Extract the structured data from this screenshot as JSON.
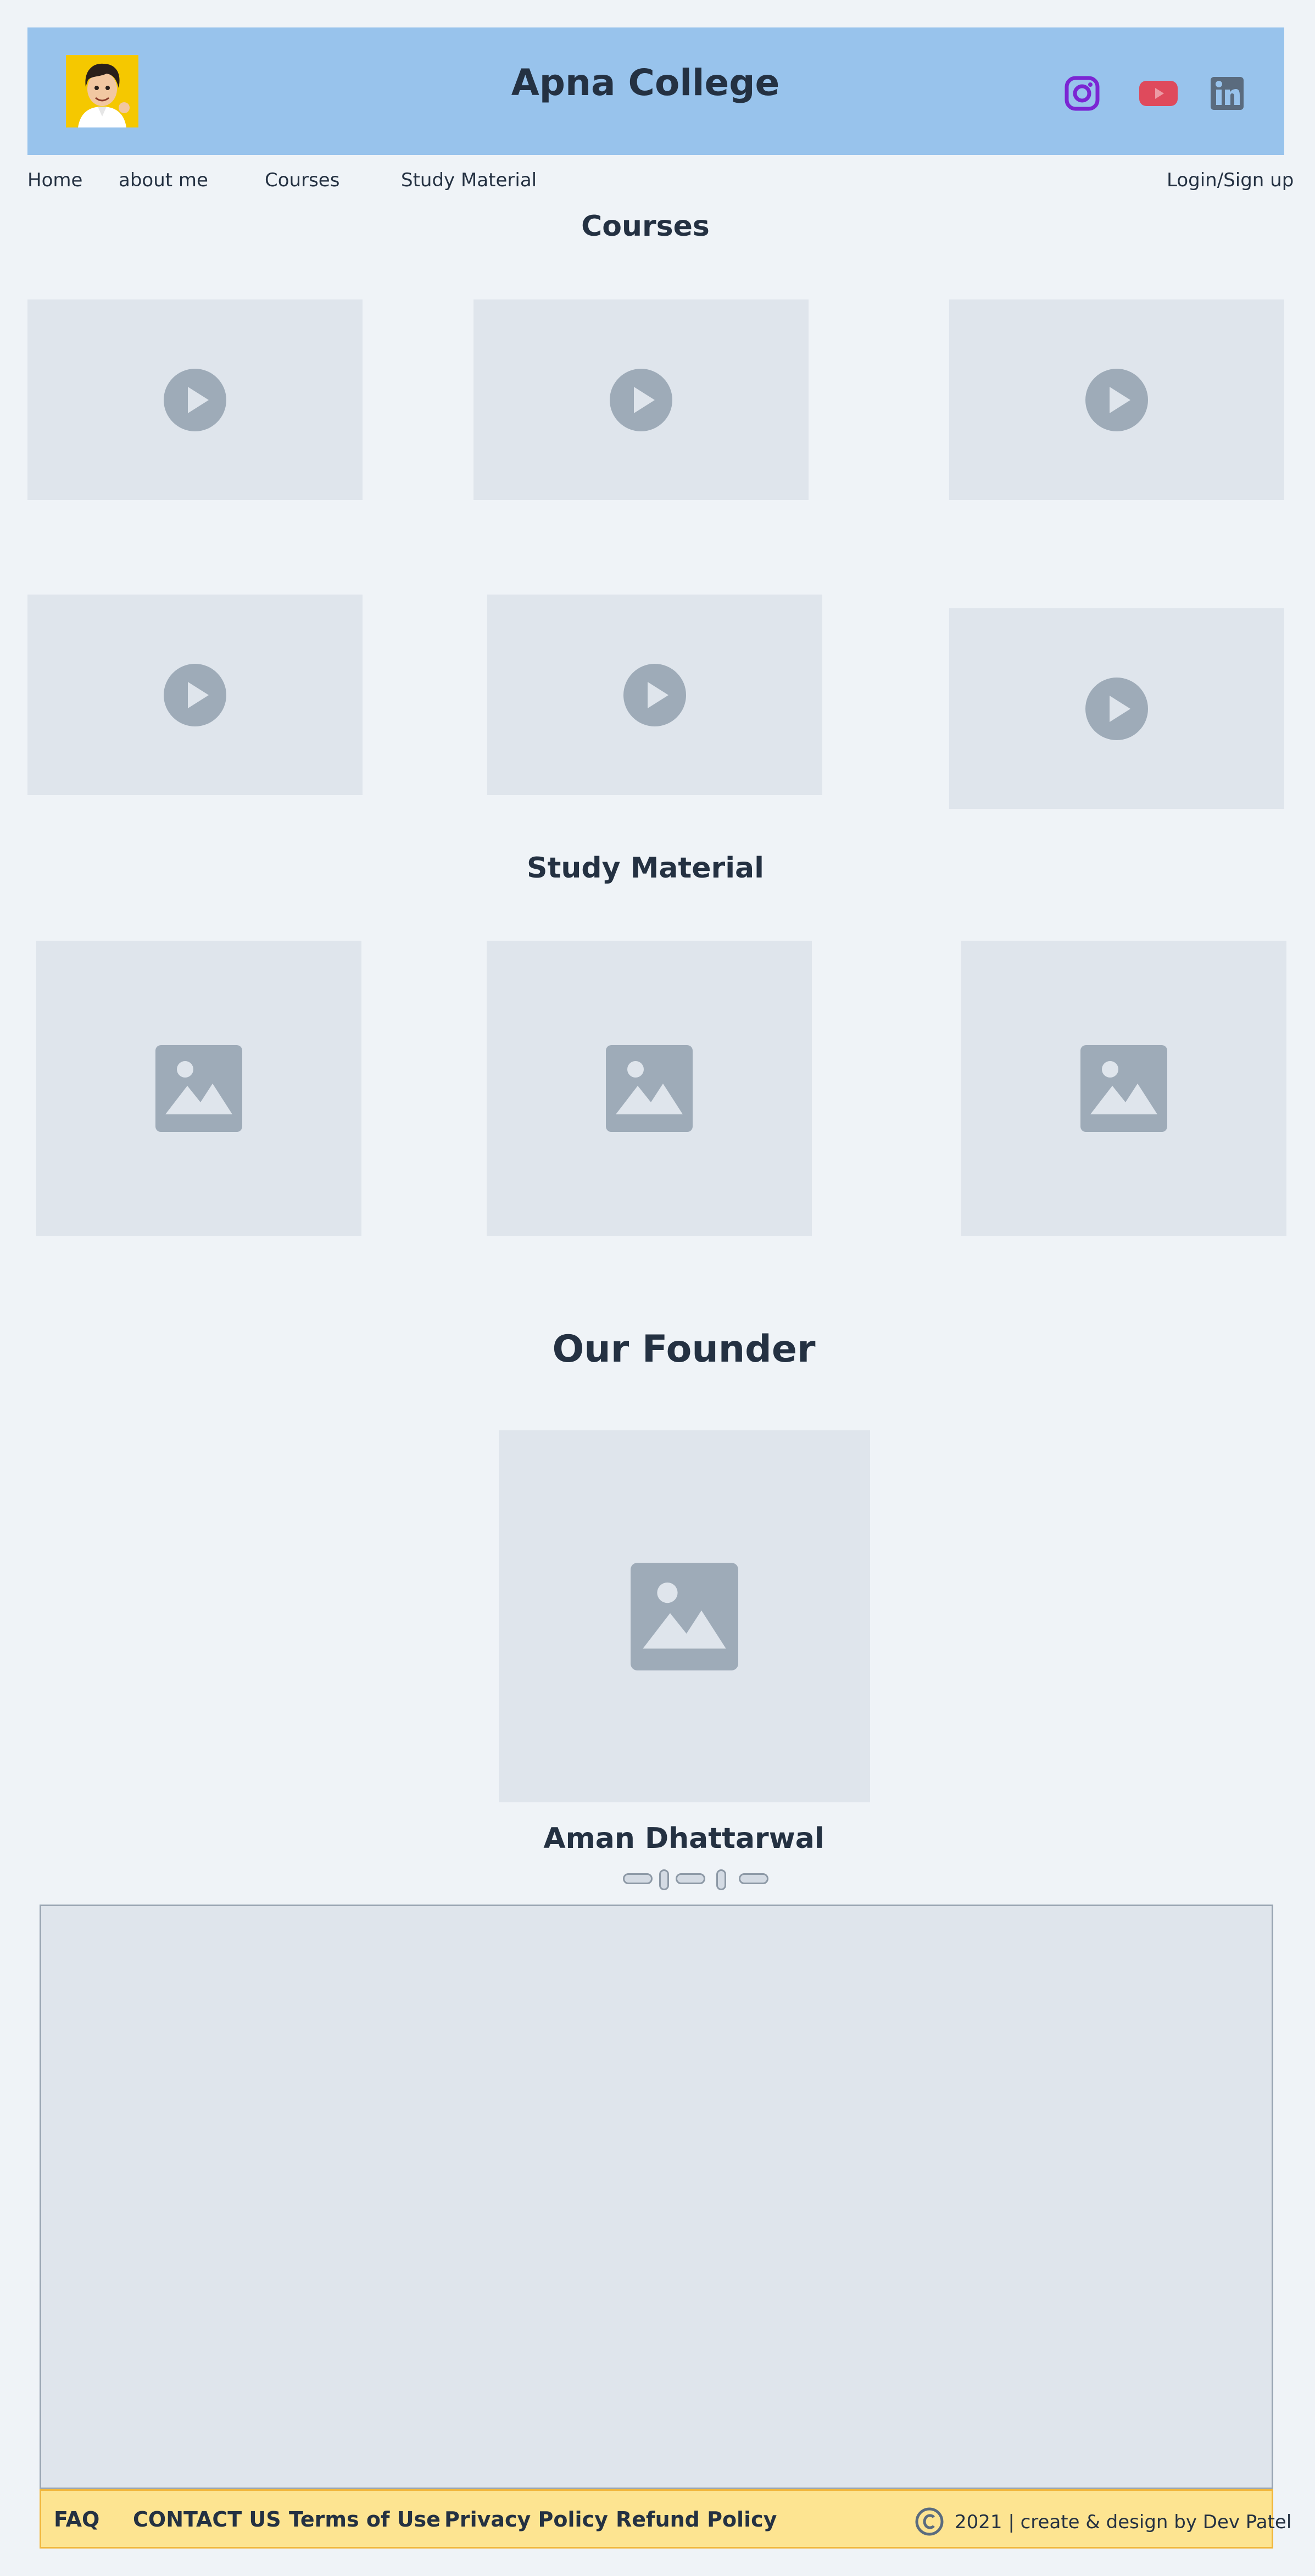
{
  "header": {
    "title": "Apna College",
    "logo_icon": "avatar-logo-icon",
    "social": [
      {
        "name": "instagram-icon",
        "color": "#7b26d3"
      },
      {
        "name": "youtube-icon",
        "color": "#df4a5c"
      },
      {
        "name": "linkedin-icon",
        "color": "#5a6b7e"
      }
    ]
  },
  "nav": {
    "items": [
      "Home",
      "about me",
      "Courses",
      "Study Material"
    ],
    "login": "Login/Sign up"
  },
  "courses": {
    "title": "Courses",
    "video_icon": "play-icon"
  },
  "study_material": {
    "title": "Study Material",
    "image_icon": "image-placeholder-icon"
  },
  "founder": {
    "title": "Our Founder",
    "name": "Aman Dhattarwal"
  },
  "footer": {
    "links": [
      "FAQ",
      "CONTACT US",
      "Terms of Use",
      "Privacy Policy",
      "Refund Policy"
    ],
    "copyright": "2021 | create & design by Dev Patel"
  },
  "colors": {
    "header_bg": "#98c3ec",
    "page_bg": "#eff3f7",
    "placeholder_bg": "#dfe5ec",
    "footer_bg": "#fde491",
    "footer_border": "#f1b73d",
    "text": "#243142"
  }
}
